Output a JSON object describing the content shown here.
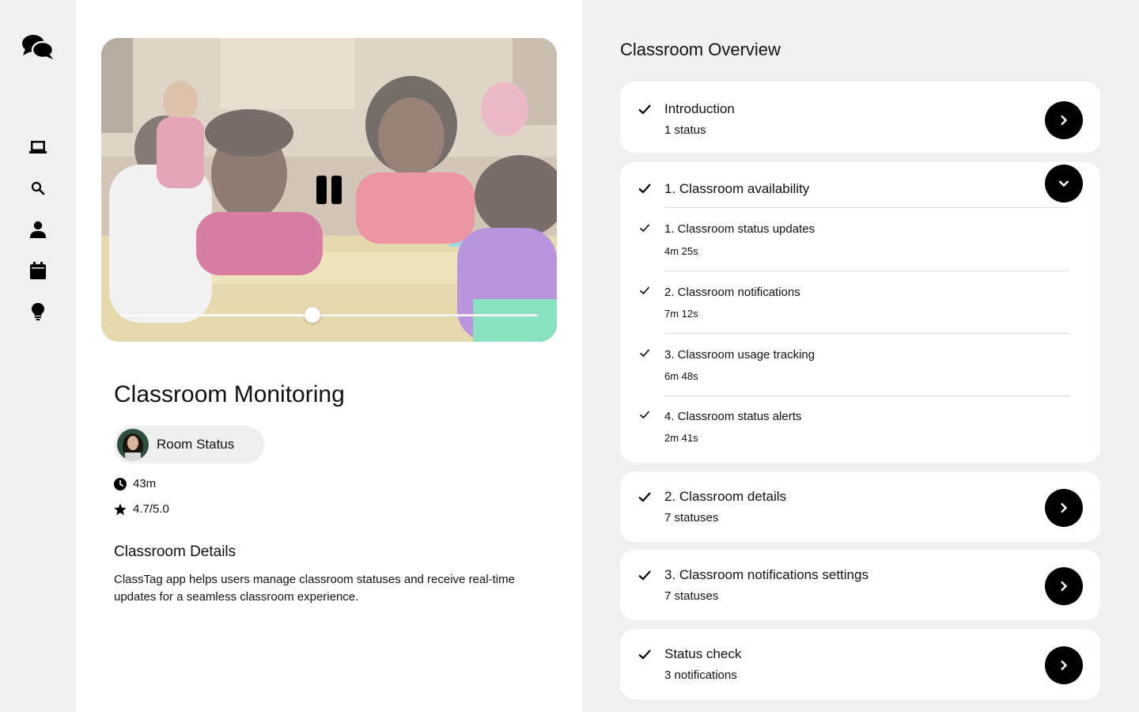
{
  "sidebar": {
    "logo_icon": "chat-bubbles-icon",
    "items": [
      {
        "icon": "classroom-screen-icon"
      },
      {
        "icon": "search-icon"
      },
      {
        "icon": "person-icon"
      },
      {
        "icon": "calendar-icon"
      },
      {
        "icon": "lightbulb-icon"
      }
    ]
  },
  "video": {
    "state": "playing",
    "control_icon": "pause-icon",
    "progress": 0.46
  },
  "course": {
    "title": "Classroom Monitoring",
    "author": "Room Status",
    "duration": "43m",
    "rating": "4.7/5.0",
    "details_heading": "Classroom Details",
    "details_text": "ClassTag app helps users manage classroom statuses and receive real-time updates for a seamless classroom experience."
  },
  "overview": {
    "title": "Classroom Overview",
    "sections": [
      {
        "title": "Introduction",
        "subtitle": "1 status",
        "expanded": false
      },
      {
        "title": "1. Classroom availability",
        "expanded": true,
        "lessons": [
          {
            "title": "1. Classroom status updates",
            "duration": "4m 25s"
          },
          {
            "title": "2. Classroom notifications",
            "duration": "7m 12s"
          },
          {
            "title": "3. Classroom usage tracking",
            "duration": "6m 48s"
          },
          {
            "title": "4. Classroom status alerts",
            "duration": "2m 41s"
          }
        ]
      },
      {
        "title": "2. Classroom details",
        "subtitle": "7 statuses",
        "expanded": false
      },
      {
        "title": "3. Classroom notifications settings",
        "subtitle": "7 statuses",
        "expanded": false
      },
      {
        "title": "Status check",
        "subtitle": "3 notifications",
        "expanded": false
      }
    ]
  }
}
